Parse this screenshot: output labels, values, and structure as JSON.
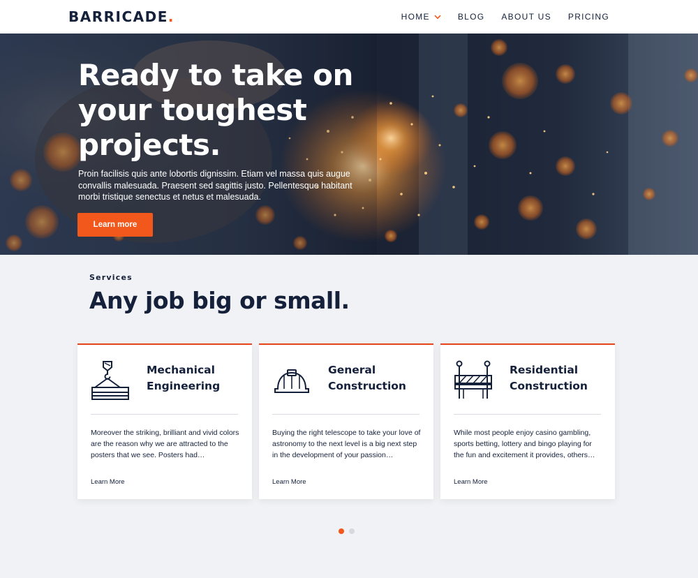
{
  "brand": {
    "name": "BARRICADE",
    "dot": "."
  },
  "nav": {
    "items": [
      {
        "label": "HOME",
        "has_dropdown": true
      },
      {
        "label": "BLOG"
      },
      {
        "label": "ABOUT US"
      },
      {
        "label": "PRICING"
      }
    ]
  },
  "hero": {
    "title_lines": [
      "Ready to take on",
      "your toughest",
      "projects."
    ],
    "text": "Proin facilisis quis ante lobortis dignissim. Etiam vel massa quis augue convallis malesuada. Praesent sed sagittis justo. Pellentesque habitant morbi tristique senectus et netus et malesuada.",
    "button_label": "Learn more"
  },
  "services": {
    "label": "Services",
    "title": "Any job big or small.",
    "cards": [
      {
        "icon": "crane-hook-icon",
        "title_lines": [
          "Mechanical",
          "Engineering"
        ],
        "text": "Moreover the striking, brilliant and vivid colors are the reason why we are attracted to the posters that we see. Posters had…",
        "link": "Learn More"
      },
      {
        "icon": "hard-hat-icon",
        "title_lines": [
          "General",
          "Construction"
        ],
        "text": "Buying the right telescope to take your love of astronomy to the next level is a big next step in the development of your passion…",
        "link": "Learn More"
      },
      {
        "icon": "barrier-icon",
        "title_lines": [
          "Residential",
          "Construction"
        ],
        "text": "While most people enjoy casino gambling, sports betting, lottery and bingo playing for the fun and excitement it provides, others…",
        "link": "Learn More"
      }
    ]
  },
  "pagination": {
    "total": 2,
    "active_index": 0
  },
  "colors": {
    "accent": "#f2571b",
    "navy": "#15213b",
    "background": "#f1f2f5",
    "card_border": "#e6431a"
  }
}
